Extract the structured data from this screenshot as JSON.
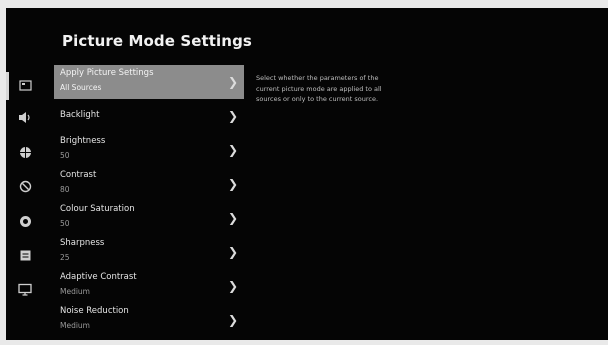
{
  "title": "Picture Mode Settings",
  "sidebar": {
    "icons": [
      "picture-icon",
      "sound-icon",
      "network-icon",
      "power-icon",
      "accessibility-icon",
      "system-icon",
      "support-icon"
    ]
  },
  "menu": {
    "items": [
      {
        "label": "Apply Picture Settings",
        "value": "All Sources",
        "selected": true
      },
      {
        "label": "Backlight",
        "value": ""
      },
      {
        "label": "Brightness",
        "value": "50"
      },
      {
        "label": "Contrast",
        "value": "80"
      },
      {
        "label": "Colour Saturation",
        "value": "50"
      },
      {
        "label": "Sharpness",
        "value": "25"
      },
      {
        "label": "Adaptive Contrast",
        "value": "Medium"
      },
      {
        "label": "Noise Reduction",
        "value": "Medium"
      }
    ]
  },
  "description": "Select whether the parameters of the current picture mode are applied to all sources or only to the current source.",
  "colors": {
    "background": "#050505",
    "selected": "#8c8c8c",
    "text": "#e6e6e6"
  }
}
